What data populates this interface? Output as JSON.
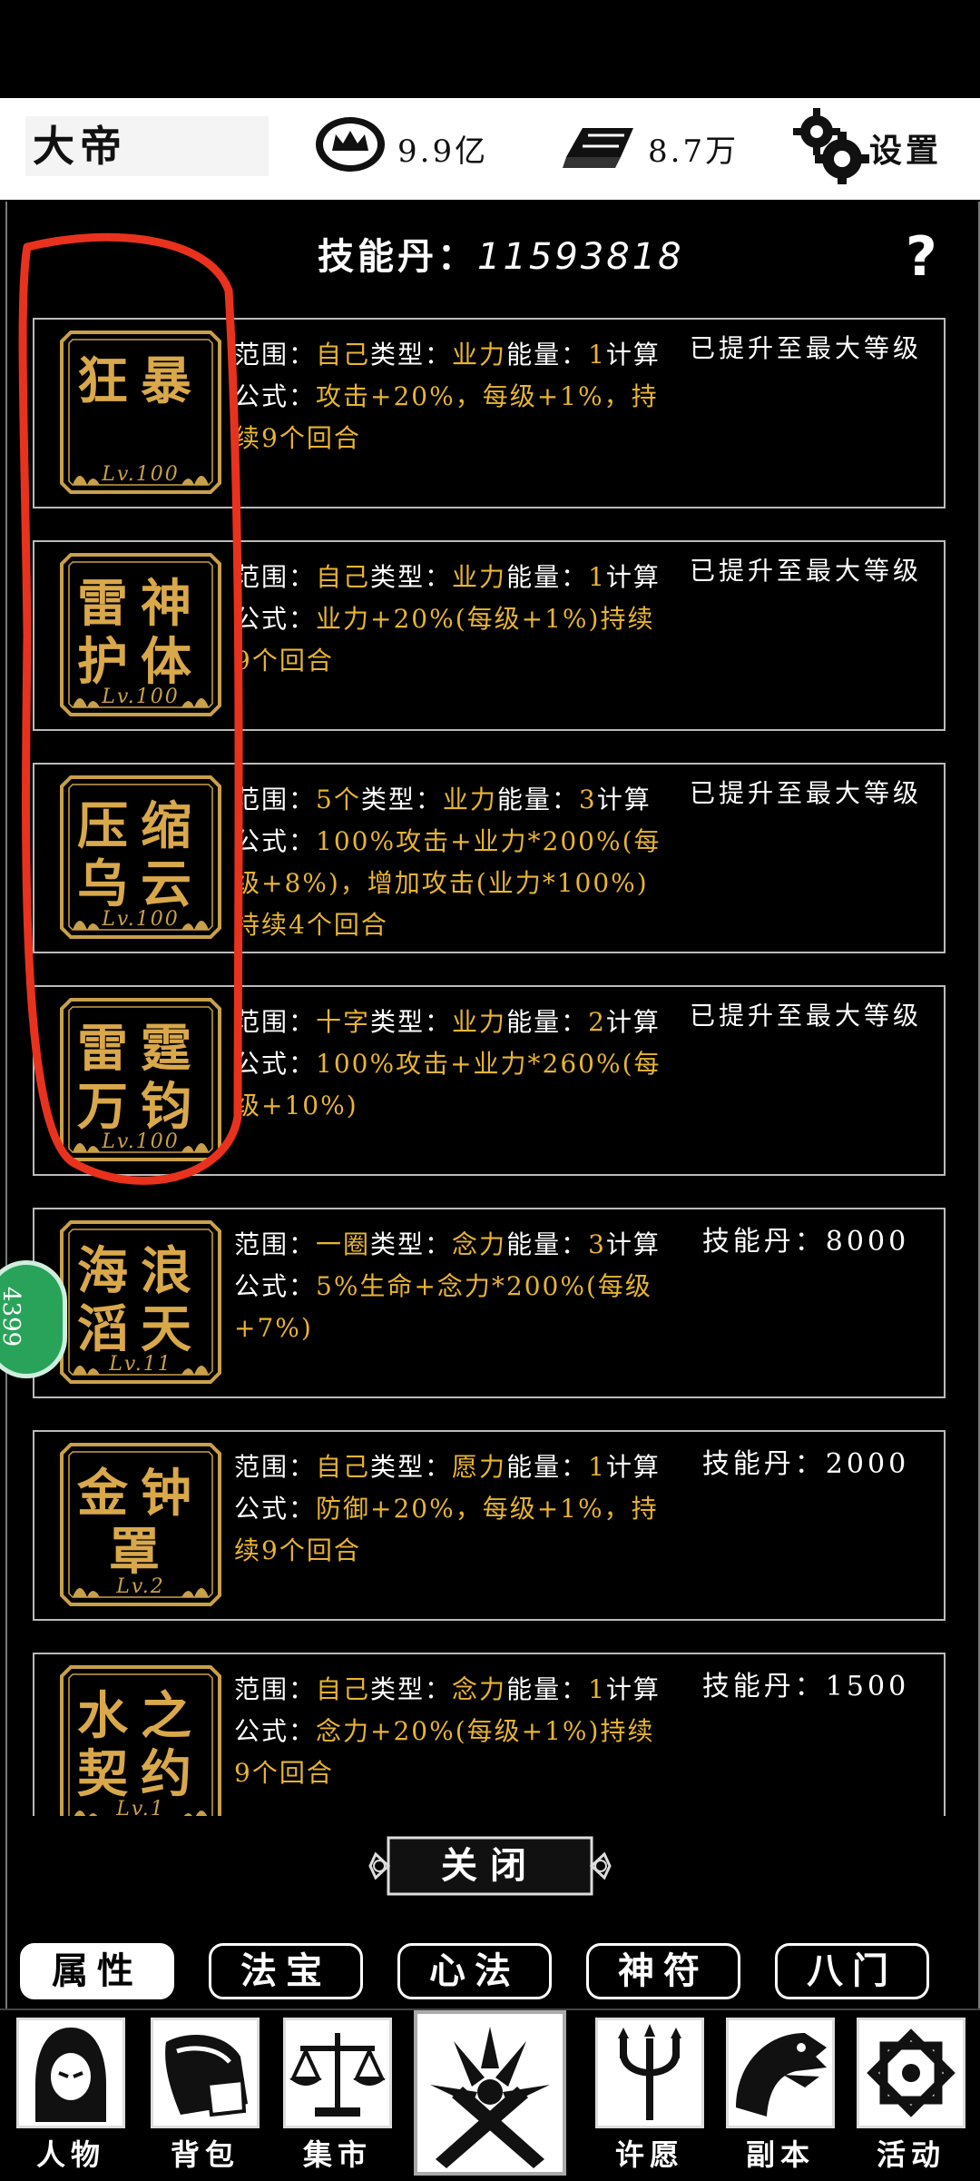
{
  "header": {
    "player_name": "大帝",
    "coins": "9.9亿",
    "ingots": "8.7万",
    "settings_label": "设置"
  },
  "panel": {
    "dan_label": "技能丹：",
    "dan_count": "11593818",
    "help_label": "?"
  },
  "skills": [
    {
      "name": "狂暴",
      "lv": "Lv.100",
      "range_label": "范围：",
      "range": "自己",
      "type_label": "类型：",
      "type": "业力",
      "energy_label": "能量：",
      "energy": "1",
      "formula_label": "计算公式：",
      "formula": "攻击+20%，每级+1%，持续9个回合",
      "status": "已提升至最大等级"
    },
    {
      "name": "雷神护体",
      "lv": "Lv.100",
      "range_label": "范围：",
      "range": "自己",
      "type_label": "类型：",
      "type": "业力",
      "energy_label": "能量：",
      "energy": "1",
      "formula_label": "计算公式：",
      "formula": "业力+20%(每级+1%)持续9个回合",
      "status": "已提升至最大等级"
    },
    {
      "name": "压缩乌云",
      "lv": "Lv.100",
      "range_label": "范围：",
      "range": "5个",
      "type_label": "类型：",
      "type": "业力",
      "energy_label": "能量：",
      "energy": "3",
      "formula_label": "计算公式：",
      "formula": "100%攻击+业力*200%(每级+8%)，增加攻击(业力*100%)持续4个回合",
      "status": "已提升至最大等级"
    },
    {
      "name": "雷霆万钧",
      "lv": "Lv.100",
      "range_label": "范围：",
      "range": "十字",
      "type_label": "类型：",
      "type": "业力",
      "energy_label": "能量：",
      "energy": "2",
      "formula_label": "计算公式：",
      "formula": "100%攻击+业力*260%(每级+10%)",
      "status": "已提升至最大等级"
    },
    {
      "name": "海浪滔天",
      "lv": "Lv.11",
      "range_label": "范围：",
      "range": "一圈",
      "type_label": "类型：",
      "type": "念力",
      "energy_label": "能量：",
      "energy": "3",
      "formula_label": "计算公式：",
      "formula": "5%生命+念力*200%(每级+7%)",
      "status": "技能丹：8000"
    },
    {
      "name": "金钟罩",
      "lv": "Lv.2",
      "range_label": "范围：",
      "range": "自己",
      "type_label": "类型：",
      "type": "愿力",
      "energy_label": "能量：",
      "energy": "1",
      "formula_label": "计算公式：",
      "formula": "防御+20%，每级+1%，持续9个回合",
      "status": "技能丹：2000"
    },
    {
      "name": "水之契约",
      "lv": "Lv.1",
      "range_label": "范围：",
      "range": "自己",
      "type_label": "类型：",
      "type": "念力",
      "energy_label": "能量：",
      "energy": "1",
      "formula_label": "计算公式：",
      "formula": "念力+20%(每级+1%)持续9个回合",
      "status": "技能丹：1500"
    }
  ],
  "close_label": "关闭",
  "tabs": [
    "属性",
    "法宝",
    "心法",
    "神符",
    "八门"
  ],
  "bottom_nav": [
    "人物",
    "背包",
    "集市",
    "许愿",
    "副本",
    "活动"
  ],
  "side_bubble": "4399",
  "colors": {
    "value_gold": "#e8b431",
    "badge_gold": "#d8a84a",
    "annotation_red": "#e8321e"
  }
}
